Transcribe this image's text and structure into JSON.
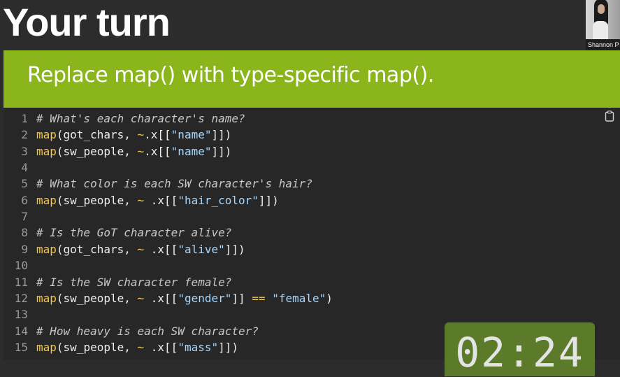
{
  "slide": {
    "title": "Your turn",
    "instruction": "Replace map() with type-specific map()."
  },
  "webcam": {
    "name": "Shannon P"
  },
  "code": [
    {
      "n": "1",
      "parts": [
        {
          "t": "cm",
          "v": "# What's each character's name?"
        }
      ]
    },
    {
      "n": "2",
      "parts": [
        {
          "t": "fn",
          "v": "map"
        },
        {
          "t": "pl",
          "v": "(got_chars, "
        },
        {
          "t": "op",
          "v": "~"
        },
        {
          "t": "pl",
          "v": ".x[["
        },
        {
          "t": "st",
          "v": "\"name\""
        },
        {
          "t": "pl",
          "v": "]])"
        }
      ]
    },
    {
      "n": "3",
      "parts": [
        {
          "t": "fn",
          "v": "map"
        },
        {
          "t": "pl",
          "v": "(sw_people, "
        },
        {
          "t": "op",
          "v": "~"
        },
        {
          "t": "pl",
          "v": ".x[["
        },
        {
          "t": "st",
          "v": "\"name\""
        },
        {
          "t": "pl",
          "v": "]])"
        }
      ]
    },
    {
      "n": "4",
      "parts": []
    },
    {
      "n": "5",
      "parts": [
        {
          "t": "cm",
          "v": "# What color is each SW character's hair?"
        }
      ]
    },
    {
      "n": "6",
      "parts": [
        {
          "t": "fn",
          "v": "map"
        },
        {
          "t": "pl",
          "v": "(sw_people, "
        },
        {
          "t": "op",
          "v": "~"
        },
        {
          "t": "pl",
          "v": " .x[["
        },
        {
          "t": "st",
          "v": "\"hair_color\""
        },
        {
          "t": "pl",
          "v": "]])"
        }
      ]
    },
    {
      "n": "7",
      "parts": []
    },
    {
      "n": "8",
      "parts": [
        {
          "t": "cm",
          "v": "# Is the GoT character alive?"
        }
      ]
    },
    {
      "n": "9",
      "parts": [
        {
          "t": "fn",
          "v": "map"
        },
        {
          "t": "pl",
          "v": "(got_chars, "
        },
        {
          "t": "op",
          "v": "~"
        },
        {
          "t": "pl",
          "v": " .x[["
        },
        {
          "t": "st",
          "v": "\"alive\""
        },
        {
          "t": "pl",
          "v": "]])"
        }
      ]
    },
    {
      "n": "10",
      "parts": []
    },
    {
      "n": "11",
      "parts": [
        {
          "t": "cm",
          "v": "# Is the SW character female?"
        }
      ]
    },
    {
      "n": "12",
      "parts": [
        {
          "t": "fn",
          "v": "map"
        },
        {
          "t": "pl",
          "v": "(sw_people, "
        },
        {
          "t": "op",
          "v": "~"
        },
        {
          "t": "pl",
          "v": " .x[["
        },
        {
          "t": "st",
          "v": "\"gender\""
        },
        {
          "t": "pl",
          "v": "]] "
        },
        {
          "t": "op",
          "v": "=="
        },
        {
          "t": "pl",
          "v": " "
        },
        {
          "t": "st",
          "v": "\"female\""
        },
        {
          "t": "pl",
          "v": ")"
        }
      ]
    },
    {
      "n": "13",
      "parts": []
    },
    {
      "n": "14",
      "parts": [
        {
          "t": "cm",
          "v": "# How heavy is each SW character?"
        }
      ]
    },
    {
      "n": "15",
      "parts": [
        {
          "t": "fn",
          "v": "map"
        },
        {
          "t": "pl",
          "v": "(sw_people, "
        },
        {
          "t": "op",
          "v": "~"
        },
        {
          "t": "pl",
          "v": " .x[["
        },
        {
          "t": "st",
          "v": "\"mass\""
        },
        {
          "t": "pl",
          "v": "]])"
        }
      ]
    }
  ],
  "timer": {
    "value": "02:24"
  },
  "icons": {
    "copy": "clipboard-icon"
  },
  "colors": {
    "banner": "#8ab61c",
    "timer": "#5b7a2a",
    "function": "#f6c744",
    "string": "#a6d8ff"
  }
}
